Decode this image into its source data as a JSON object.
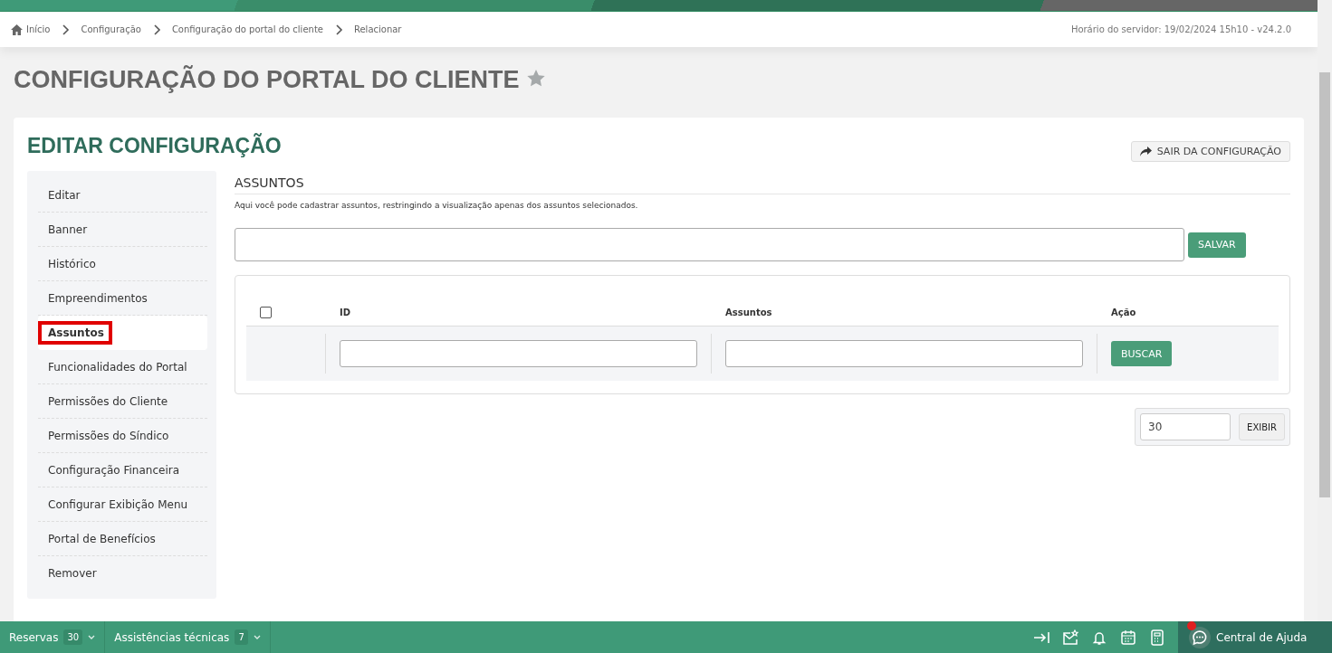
{
  "breadcrumb": [
    {
      "label": "Início",
      "kind": "home"
    },
    {
      "label": "Configuração",
      "kind": "link"
    },
    {
      "label": "Configuração do portal do cliente",
      "kind": "link"
    },
    {
      "label": "Relacionar",
      "kind": "link"
    }
  ],
  "server_time": "Horário do servidor: 19/02/2024 15h10 - v24.2.0",
  "page_title": "CONFIGURAÇÃO DO PORTAL DO CLIENTE",
  "favorite": false,
  "card": {
    "title": "EDITAR CONFIGURAÇÃO",
    "exit_button": "SAIR DA CONFIGURAÇÃO"
  },
  "sidebar": {
    "items": [
      {
        "label": "Editar",
        "selected": false
      },
      {
        "label": "Banner",
        "selected": false
      },
      {
        "label": "Histórico",
        "selected": false
      },
      {
        "label": "Empreendimentos",
        "selected": false
      },
      {
        "label": "Assuntos",
        "selected": true
      },
      {
        "label": "Funcionalidades do Portal",
        "selected": false
      },
      {
        "label": "Permissões do Cliente",
        "selected": false
      },
      {
        "label": "Permissões do Síndico",
        "selected": false
      },
      {
        "label": "Configuração Financeira",
        "selected": false
      },
      {
        "label": "Configurar Exibição Menu",
        "selected": false
      },
      {
        "label": "Portal de Benefícios",
        "selected": false
      },
      {
        "label": "Remover",
        "selected": false
      }
    ]
  },
  "section": {
    "title": "ASSUNTOS",
    "description": "Aqui você pode cadastrar assuntos, restringindo a visualização apenas dos assuntos selecionados.",
    "save_button": "SALVAR"
  },
  "table": {
    "select_all": {
      "checked": false
    },
    "columns": [
      "ID",
      "Assuntos",
      "Ação"
    ],
    "search_button": "BUSCAR"
  },
  "pagination": {
    "page_size": "30",
    "show_button": "EXIBIR"
  },
  "bottom_bar": {
    "tabs": [
      {
        "label": "Reservas",
        "count": "30"
      },
      {
        "label": "Assistências técnicas",
        "count": "7"
      }
    ],
    "help": {
      "label": "Central de Ajuda",
      "notification": true
    }
  }
}
